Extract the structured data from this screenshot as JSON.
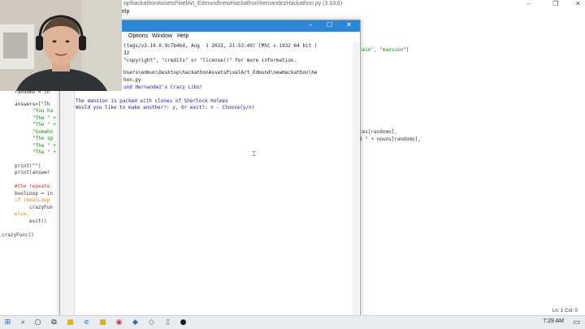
{
  "editor": {
    "title": "op\\hackathonAssetsPixelArt_Edmund\\newHackathon\\hernandezHackathon.py (3.10.6)",
    "menu_partial": "elp",
    "right_code": [
      "tein\", \"mansion\"]",
      "ces[randomo],",
      "d \" + nouns[randomo],"
    ],
    "left_code": [
      "randomo = in",
      "answers=[\"Th",
      "\"You ha",
      "\"The \" +",
      "\"The \" +",
      "\"Someho",
      "\"The sp",
      "\"The \" +",
      "\"The \" +",
      "print(\"\")",
      "print(answer",
      "#the repeate",
      "boolLoop = in",
      "if (boolLoop",
      "crazyFun",
      "else:",
      "exit()",
      "crazyFunc()"
    ],
    "status": "Ln: 1   Col: 0"
  },
  "shell": {
    "menu": [
      "Options",
      "Window",
      "Help"
    ],
    "lines": [
      "(tags/v3.10.6:9c7b4bd, Aug  1 2022, 21:53:49) [MSC v.1932 64 bit (",
      "32",
      "\"copyright\", \"credits\" or \"license()\" for more information.",
      "",
      "Users\\edmun\\Desktop\\hackathonAssetsPixelArt_Edmund\\newHackathon\\he",
      "hon.py",
      "und Hernandez's Crazy Libs!"
    ],
    "output": [
      "The mansion is packed with clones of Sherlock Holmes",
      "Would you like to make another?: y, Or exit?: n - Choose(y/n)"
    ]
  },
  "taskbar": {
    "icons": [
      "windows-start-icon",
      "search-icon",
      "cortana-icon",
      "task-view-icon",
      "file-explorer-icon",
      "edge-icon",
      "chrome-icon",
      "python-idle-icon",
      "photos-icon",
      "notepad-icon",
      "obs-icon"
    ],
    "clock": "7:29 AM"
  },
  "colors": {
    "titlebar": "#2b86d6",
    "keyword": "#e07a00",
    "string": "#0a8a0a",
    "output": "#1a1aa8"
  }
}
